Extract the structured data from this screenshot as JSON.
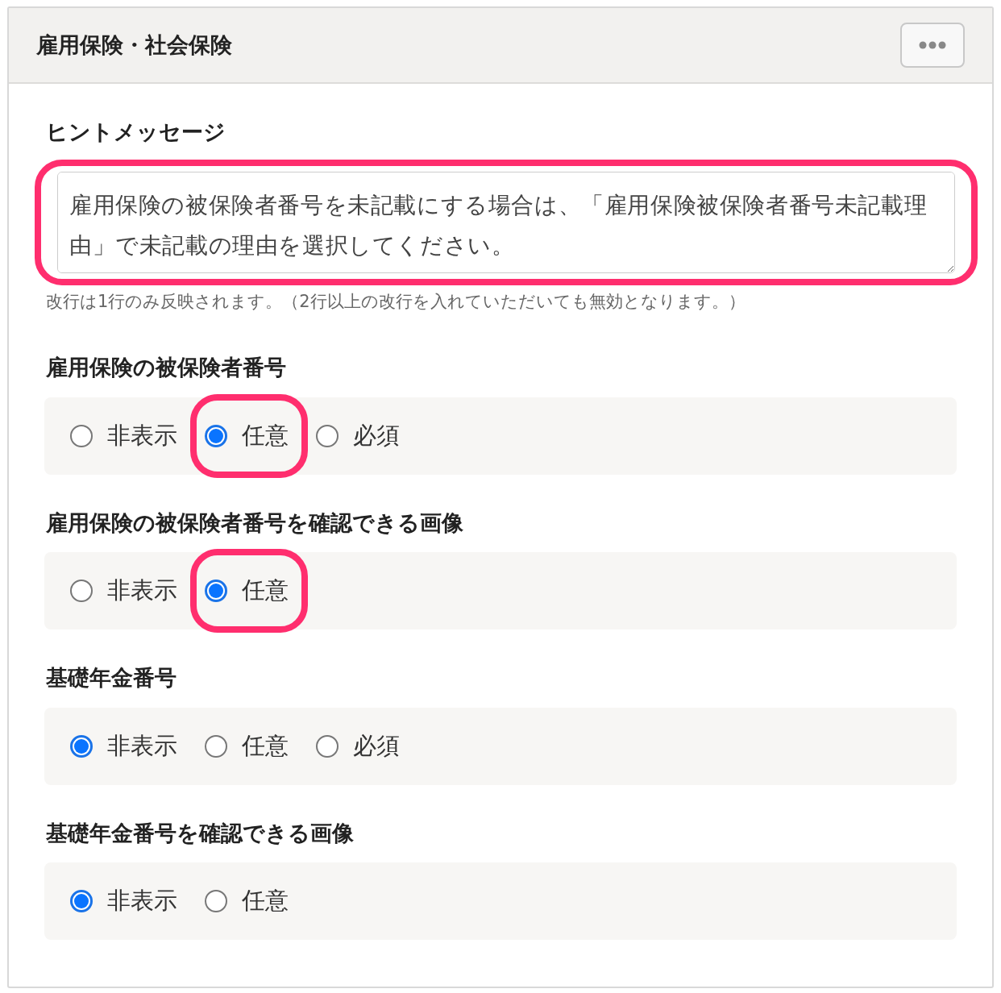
{
  "panel": {
    "title": "雇用保険・社会保険"
  },
  "hint": {
    "label": "ヒントメッセージ",
    "value": "雇用保険の被保険者番号を未記載にする場合は、「雇用保険被保険者番号未記載理由」で未記載の理由を選択してください。",
    "highlighted": true,
    "note": "改行は1行のみ反映されます。（2行以上の改行を入れていただいても無効となります。）"
  },
  "groups": [
    {
      "label": "雇用保険の被保険者番号",
      "options": [
        {
          "label": "非表示",
          "selected": false,
          "highlighted": false
        },
        {
          "label": "任意",
          "selected": true,
          "highlighted": true
        },
        {
          "label": "必須",
          "selected": false,
          "highlighted": false
        }
      ]
    },
    {
      "label": "雇用保険の被保険者番号を確認できる画像",
      "options": [
        {
          "label": "非表示",
          "selected": false,
          "highlighted": false
        },
        {
          "label": "任意",
          "selected": true,
          "highlighted": true
        }
      ]
    },
    {
      "label": "基礎年金番号",
      "options": [
        {
          "label": "非表示",
          "selected": true,
          "highlighted": false
        },
        {
          "label": "任意",
          "selected": false,
          "highlighted": false
        },
        {
          "label": "必須",
          "selected": false,
          "highlighted": false
        }
      ]
    },
    {
      "label": "基礎年金番号を確認できる画像",
      "options": [
        {
          "label": "非表示",
          "selected": true,
          "highlighted": false
        },
        {
          "label": "任意",
          "selected": false,
          "highlighted": false
        }
      ]
    }
  ]
}
